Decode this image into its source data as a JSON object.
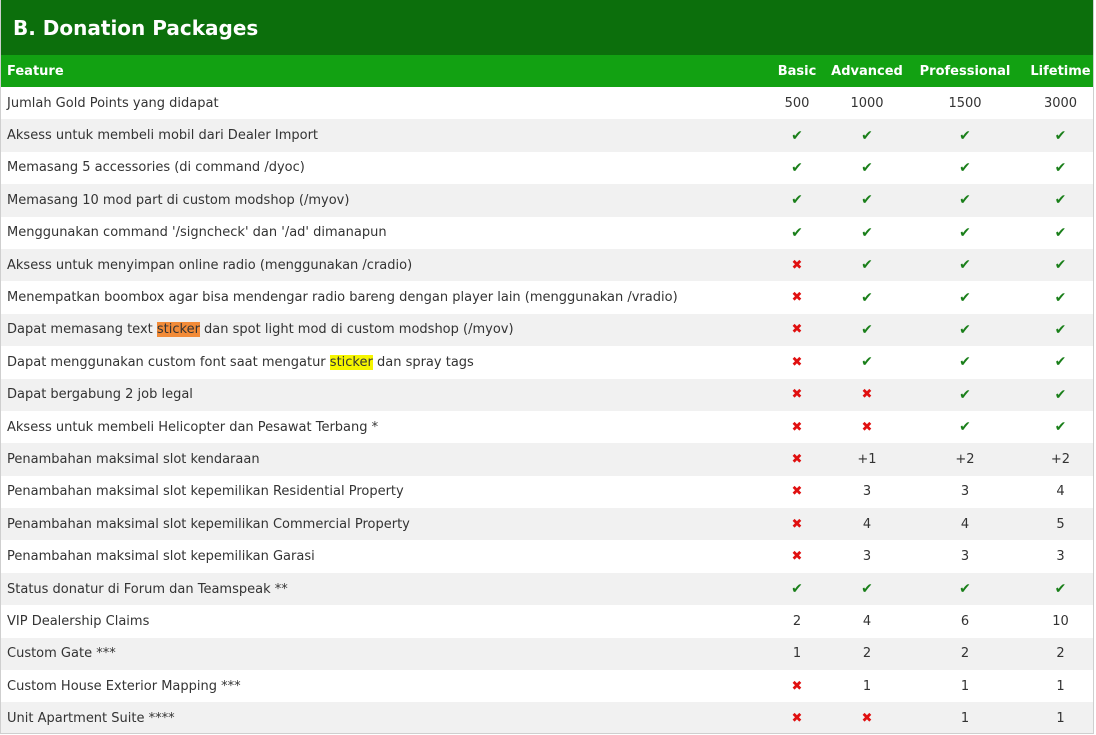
{
  "title": "B. Donation Packages",
  "colors": {
    "title_bg": "#0c6f0c",
    "header_bg": "#12a112",
    "yes": "#1a7f1a",
    "no": "#e01010"
  },
  "columns": [
    "Feature",
    "Basic",
    "Advanced",
    "Professional",
    "Lifetime"
  ],
  "rows": [
    {
      "feature": "Jumlah Gold Points yang didapat",
      "values": [
        "500",
        "1000",
        "1500",
        "3000"
      ]
    },
    {
      "feature": "Aksess untuk membeli mobil dari Dealer Import",
      "values": [
        "yes",
        "yes",
        "yes",
        "yes"
      ]
    },
    {
      "feature": "Memasang 5 accessories (di command /dyoc)",
      "values": [
        "yes",
        "yes",
        "yes",
        "yes"
      ]
    },
    {
      "feature": "Memasang 10 mod part di custom modshop (/myov)",
      "values": [
        "yes",
        "yes",
        "yes",
        "yes"
      ]
    },
    {
      "feature": "Menggunakan command '/signcheck' dan '/ad' dimanapun",
      "values": [
        "yes",
        "yes",
        "yes",
        "yes"
      ]
    },
    {
      "feature": "Aksess untuk menyimpan online radio (menggunakan /cradio)",
      "values": [
        "no",
        "yes",
        "yes",
        "yes"
      ]
    },
    {
      "feature": "Menempatkan boombox agar bisa mendengar radio bareng dengan player lain (menggunakan /vradio)",
      "values": [
        "no",
        "yes",
        "yes",
        "yes"
      ]
    },
    {
      "feature_parts": [
        "Dapat memasang text ",
        "sticker",
        " dan spot light mod di custom modshop (/myov)"
      ],
      "highlight": "orange",
      "values": [
        "no",
        "yes",
        "yes",
        "yes"
      ]
    },
    {
      "feature_parts": [
        "Dapat menggunakan custom font saat mengatur ",
        "sticker",
        " dan spray tags"
      ],
      "highlight": "yellow",
      "values": [
        "no",
        "yes",
        "yes",
        "yes"
      ]
    },
    {
      "feature": "Dapat bergabung 2 job legal",
      "values": [
        "no",
        "no",
        "yes",
        "yes"
      ]
    },
    {
      "feature": "Aksess untuk membeli Helicopter dan Pesawat Terbang *",
      "values": [
        "no",
        "no",
        "yes",
        "yes"
      ]
    },
    {
      "feature": "Penambahan maksimal slot kendaraan",
      "values": [
        "no",
        "+1",
        "+2",
        "+2"
      ]
    },
    {
      "feature": "Penambahan maksimal slot kepemilikan Residential Property",
      "values": [
        "no",
        "3",
        "3",
        "4"
      ]
    },
    {
      "feature": "Penambahan maksimal slot kepemilikan Commercial Property",
      "values": [
        "no",
        "4",
        "4",
        "5"
      ]
    },
    {
      "feature": "Penambahan maksimal slot kepemilikan Garasi",
      "values": [
        "no",
        "3",
        "3",
        "3"
      ]
    },
    {
      "feature": "Status donatur di Forum dan Teamspeak **",
      "values": [
        "yes",
        "yes",
        "yes",
        "yes"
      ]
    },
    {
      "feature": "VIP Dealership Claims",
      "values": [
        "2",
        "4",
        "6",
        "10"
      ]
    },
    {
      "feature": "Custom Gate ***",
      "values": [
        "1",
        "2",
        "2",
        "2"
      ]
    },
    {
      "feature": "Custom House Exterior Mapping ***",
      "values": [
        "no",
        "1",
        "1",
        "1"
      ]
    },
    {
      "feature": "Unit Apartment Suite ****",
      "values": [
        "no",
        "no",
        "1",
        "1"
      ]
    }
  ]
}
